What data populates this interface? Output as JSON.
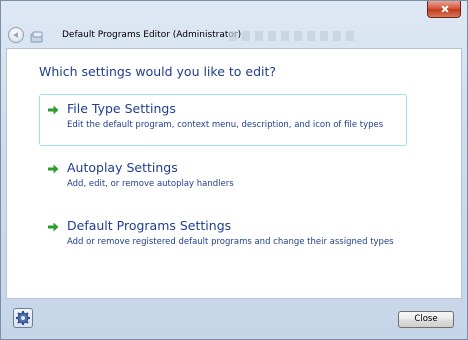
{
  "window": {
    "title": "Default Programs Editor (Administrator)"
  },
  "main": {
    "heading": "Which settings would you like to edit?",
    "options": [
      {
        "title": "File Type Settings",
        "description": "Edit the default program, context menu, description, and icon of file types"
      },
      {
        "title": "Autoplay Settings",
        "description": "Add, edit, or remove autoplay handlers"
      },
      {
        "title": "Default Programs Settings",
        "description": "Add or remove registered default programs and change their assigned types"
      }
    ]
  },
  "footer": {
    "settings_icon": "gear-icon",
    "close_label": "Close"
  },
  "colors": {
    "link_blue": "#1e3e8f",
    "arrow_green": "#2e9b2e",
    "hover_border": "#a8dcef"
  }
}
